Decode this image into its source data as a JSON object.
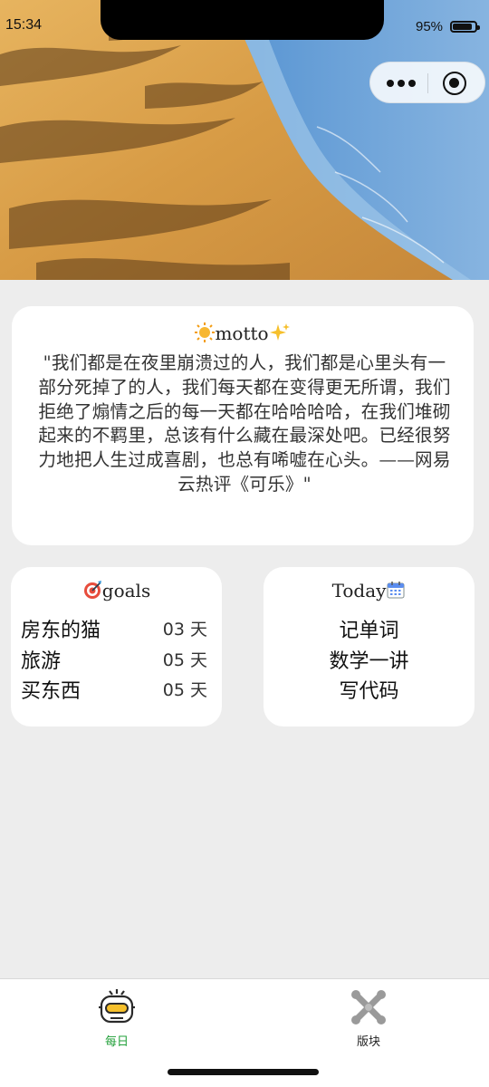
{
  "status_bar": {
    "time": "15:34",
    "battery_percent_text": "95%",
    "battery_level": 0.95
  },
  "capsule": {
    "more_icon": "more-dots-icon",
    "close_icon": "target-close-icon"
  },
  "motto": {
    "title": "motto",
    "title_icons": [
      "sun-emoji-icon",
      "sparkles-emoji-icon"
    ],
    "text": "\"我们都是在夜里崩溃过的人，我们都是心里头有一部分死掉了的人，我们每天都在变得更无所谓，我们拒绝了煽情之后的每一天都在哈哈哈哈，在我们堆砌起来的不羁里，总该有什么藏在最深处吧。已经很努力地把人生过成喜剧，也总有唏嘘在心头。——网易云热评《可乐》\""
  },
  "goals": {
    "title": "goals",
    "title_icon": "target-emoji-icon",
    "items": [
      {
        "name": "房东的猫",
        "days": "03 天"
      },
      {
        "name": "旅游",
        "days": "05 天"
      },
      {
        "name": "买东西",
        "days": "05 天"
      }
    ]
  },
  "today": {
    "title": "Today",
    "title_icon": "calendar-emoji-icon",
    "items": [
      "记单词",
      "数学一讲",
      "写代码"
    ]
  },
  "tabbar": {
    "tabs": [
      {
        "label": "每日",
        "icon": "robot-icon",
        "active": true,
        "color": "#22a03a"
      },
      {
        "label": "版块",
        "icon": "cross-tools-icon",
        "active": false,
        "color": "#222222"
      }
    ]
  }
}
